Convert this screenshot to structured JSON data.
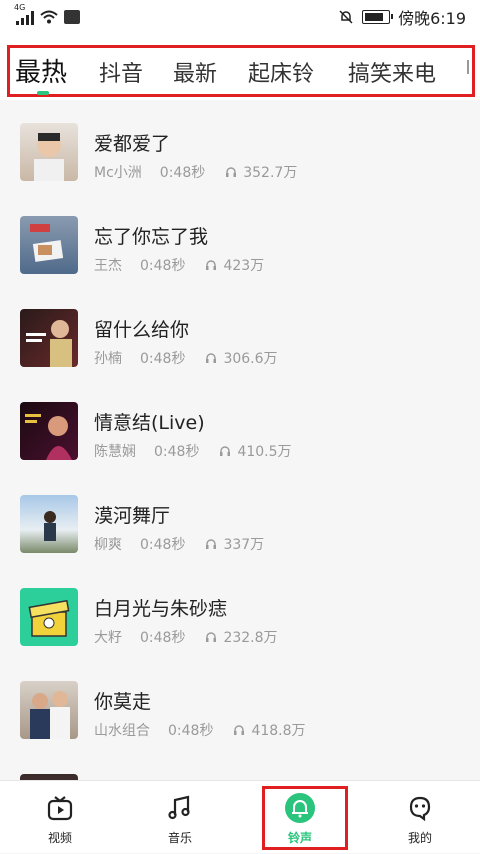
{
  "status_bar": {
    "network": "4G",
    "time": "傍晚6:19"
  },
  "tabs": [
    {
      "label": "最热",
      "active": true
    },
    {
      "label": "抖音",
      "active": false
    },
    {
      "label": "最新",
      "active": false
    },
    {
      "label": "起床铃",
      "active": false
    },
    {
      "label": "搞笑来电",
      "active": false
    }
  ],
  "songs": [
    {
      "title": "爱都爱了",
      "artist": "Mc小洲",
      "duration": "0:48秒",
      "plays": "352.7万"
    },
    {
      "title": "忘了你忘了我",
      "artist": "王杰",
      "duration": "0:48秒",
      "plays": "423万"
    },
    {
      "title": "留什么给你",
      "artist": "孙楠",
      "duration": "0:48秒",
      "plays": "306.6万"
    },
    {
      "title": "情意结(Live)",
      "artist": "陈慧娴",
      "duration": "0:48秒",
      "plays": "410.5万"
    },
    {
      "title": "漠河舞厅",
      "artist": "柳爽",
      "duration": "0:48秒",
      "plays": "337万"
    },
    {
      "title": "白月光与朱砂痣",
      "artist": "大籽",
      "duration": "0:48秒",
      "plays": "232.8万"
    },
    {
      "title": "你莫走",
      "artist": "山水组合",
      "duration": "0:48秒",
      "plays": "418.8万"
    }
  ],
  "bottom_nav": [
    {
      "label": "视频",
      "icon": "tv-icon"
    },
    {
      "label": "音乐",
      "icon": "music-note-icon"
    },
    {
      "label": "铃声",
      "icon": "bell-icon",
      "active": true
    },
    {
      "label": "我的",
      "icon": "profile-face-icon"
    }
  ],
  "colors": {
    "accent": "#2bc47c",
    "highlight_frame": "#e02020"
  }
}
